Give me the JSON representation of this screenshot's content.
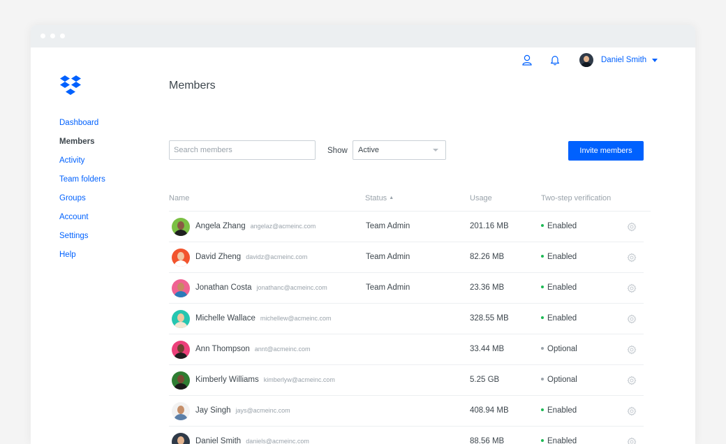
{
  "window": {
    "controls": [
      "close",
      "minimize",
      "maximize"
    ]
  },
  "topbar": {
    "user_icon": "user-icon",
    "bell_icon": "bell-icon",
    "user_name": "Daniel Smith"
  },
  "sidebar": {
    "logo": "dropbox-logo",
    "items": [
      {
        "label": "Dashboard",
        "active": false
      },
      {
        "label": "Members",
        "active": true
      },
      {
        "label": "Activity",
        "active": false
      },
      {
        "label": "Team folders",
        "active": false
      },
      {
        "label": "Groups",
        "active": false
      },
      {
        "label": "Account",
        "active": false
      },
      {
        "label": "Settings",
        "active": false
      },
      {
        "label": "Help",
        "active": false
      }
    ]
  },
  "main": {
    "title": "Members",
    "search_placeholder": "Search members",
    "show_label": "Show",
    "show_value": "Active",
    "invite_label": "Invite members"
  },
  "table": {
    "headers": {
      "name": "Name",
      "status": "Status",
      "usage": "Usage",
      "verification": "Two-step verification"
    },
    "rows": [
      {
        "name": "Angela Zhang",
        "email": "angelaz@acmeinc.com",
        "status": "Team Admin",
        "usage": "201.16 MB",
        "verification": "Enabled",
        "avatar_bg": "#7bc043",
        "skin": "#8a5a44",
        "shirt": "#1f1f1f"
      },
      {
        "name": "David Zheng",
        "email": "davidz@acmeinc.com",
        "status": "Team Admin",
        "usage": "82.26 MB",
        "verification": "Enabled",
        "avatar_bg": "#f2542d",
        "skin": "#f1c7a3",
        "shirt": "#ffffff"
      },
      {
        "name": "Jonathan Costa",
        "email": "jonathanc@acmeinc.com",
        "status": "Team Admin",
        "usage": "23.36 MB",
        "verification": "Enabled",
        "avatar_bg": "#f06292",
        "skin": "#c68a63",
        "shirt": "#2b7bb9"
      },
      {
        "name": "Michelle Wallace",
        "email": "michellew@acmeinc.com",
        "status": "",
        "usage": "328.55 MB",
        "verification": "Enabled",
        "avatar_bg": "#26c6b0",
        "skin": "#f0c8a0",
        "shirt": "#f5e6d3"
      },
      {
        "name": "Ann Thompson",
        "email": "annt@acmeinc.com",
        "status": "",
        "usage": "33.44 MB",
        "verification": "Optional",
        "avatar_bg": "#ec407a",
        "skin": "#6d4330",
        "shirt": "#1f1f1f"
      },
      {
        "name": "Kimberly Williams",
        "email": "kimberlyw@acmeinc.com",
        "status": "",
        "usage": "5.25 GB",
        "verification": "Optional",
        "avatar_bg": "#2e7d32",
        "skin": "#7a4a34",
        "shirt": "#1a1a1a"
      },
      {
        "name": "Jay Singh",
        "email": "jays@acmeinc.com",
        "status": "",
        "usage": "408.94 MB",
        "verification": "Enabled",
        "avatar_bg": "#f2f2f2",
        "skin": "#c58f6a",
        "shirt": "#5b7fa8"
      },
      {
        "name": "Daniel Smith",
        "email": "daniels@acmeinc.com",
        "status": "",
        "usage": "88.56 MB",
        "verification": "Enabled",
        "avatar_bg": "#2f3a48",
        "skin": "#e3b48f",
        "shirt": "#1c232c"
      }
    ]
  },
  "colors": {
    "accent": "#0061fe",
    "enabled": "#1db954",
    "optional": "#9aa3ab"
  }
}
